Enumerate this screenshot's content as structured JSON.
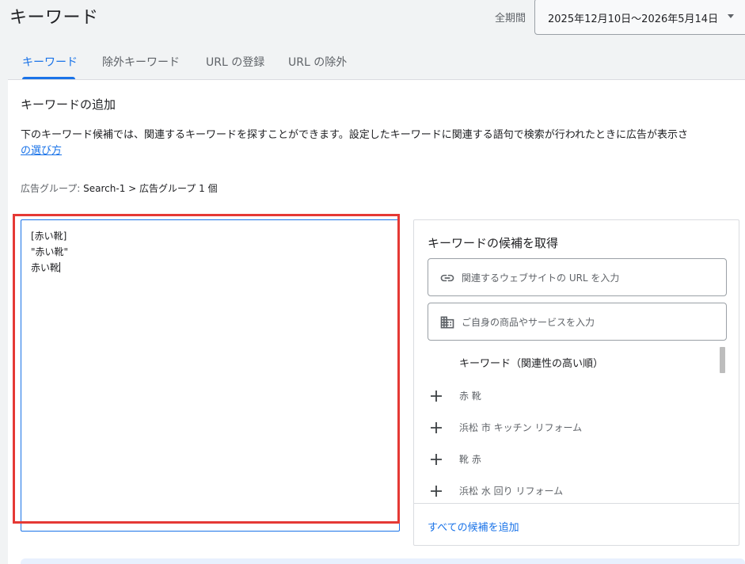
{
  "header": {
    "title": "キーワード",
    "date_label": "全期間",
    "date_range": "2025年12月10日〜2026年5月14日"
  },
  "tabs": [
    {
      "label": "キーワード",
      "active": true
    },
    {
      "label": "除外キーワード",
      "active": false
    },
    {
      "label": "URL の登録",
      "active": false
    },
    {
      "label": "URL の除外",
      "active": false
    }
  ],
  "main": {
    "section_title": "キーワードの追加",
    "description": "下のキーワード候補では、関連するキーワードを探すことができます。設定したキーワードに関連する語句で検索が行われたときに広告が表示さ",
    "description_link": "の選び方",
    "ad_group_label": "広告グループ:",
    "ad_group_value": "Search-1 > 広告グループ 1 個",
    "keywords": [
      "[赤い靴]",
      "\"赤い靴\"",
      "赤い靴"
    ]
  },
  "suggestions": {
    "title": "キーワードの候補を取得",
    "url_placeholder": "関連するウェブサイトの URL を入力",
    "product_placeholder": "ご自身の商品やサービスを入力",
    "list_header": "キーワード（関連性の高い順）",
    "items": [
      "赤 靴",
      "浜松 市 キッチン リフォーム",
      "靴 赤",
      "浜松 水 回り リフォーム"
    ],
    "add_all": "すべての候補を追加"
  },
  "colors": {
    "accent": "#1a73e8",
    "highlight": "#e53935",
    "background": "#f1f3f4"
  },
  "icons": {
    "url_field": "link-icon",
    "product_field": "building-icon",
    "suggestion": "plus-icon",
    "date_dropdown": "caret-down-icon"
  }
}
